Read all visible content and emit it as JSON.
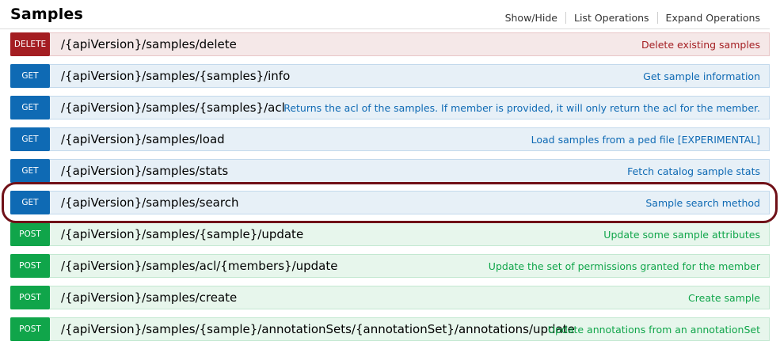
{
  "section": {
    "title": "Samples",
    "links": {
      "show_hide": "Show/Hide",
      "list_operations": "List Operations",
      "expand_operations": "Expand Operations"
    }
  },
  "operations": [
    {
      "method": "DELETE",
      "path": "/{apiVersion}/samples/delete",
      "summary": "Delete existing samples"
    },
    {
      "method": "GET",
      "path": "/{apiVersion}/samples/{samples}/info",
      "summary": "Get sample information"
    },
    {
      "method": "GET",
      "path": "/{apiVersion}/samples/{samples}/acl",
      "summary": "Returns the acl of the samples. If member is provided, it will only return the acl for the member."
    },
    {
      "method": "GET",
      "path": "/{apiVersion}/samples/load",
      "summary": "Load samples from a ped file [EXPERIMENTAL]"
    },
    {
      "method": "GET",
      "path": "/{apiVersion}/samples/stats",
      "summary": "Fetch catalog sample stats"
    },
    {
      "method": "GET",
      "path": "/{apiVersion}/samples/search",
      "summary": "Sample search method",
      "highlighted": true
    },
    {
      "method": "POST",
      "path": "/{apiVersion}/samples/{sample}/update",
      "summary": "Update some sample attributes"
    },
    {
      "method": "POST",
      "path": "/{apiVersion}/samples/acl/{members}/update",
      "summary": "Update the set of permissions granted for the member"
    },
    {
      "method": "POST",
      "path": "/{apiVersion}/samples/create",
      "summary": "Create sample"
    },
    {
      "method": "POST",
      "path": "/{apiVersion}/samples/{sample}/annotationSets/{annotationSet}/annotations/update",
      "summary": "Update annotations from an annotationSet"
    }
  ],
  "colors": {
    "delete": "#a41e22",
    "get": "#0f6ab4",
    "post": "#10a54a",
    "highlight_ring": "#701118"
  }
}
